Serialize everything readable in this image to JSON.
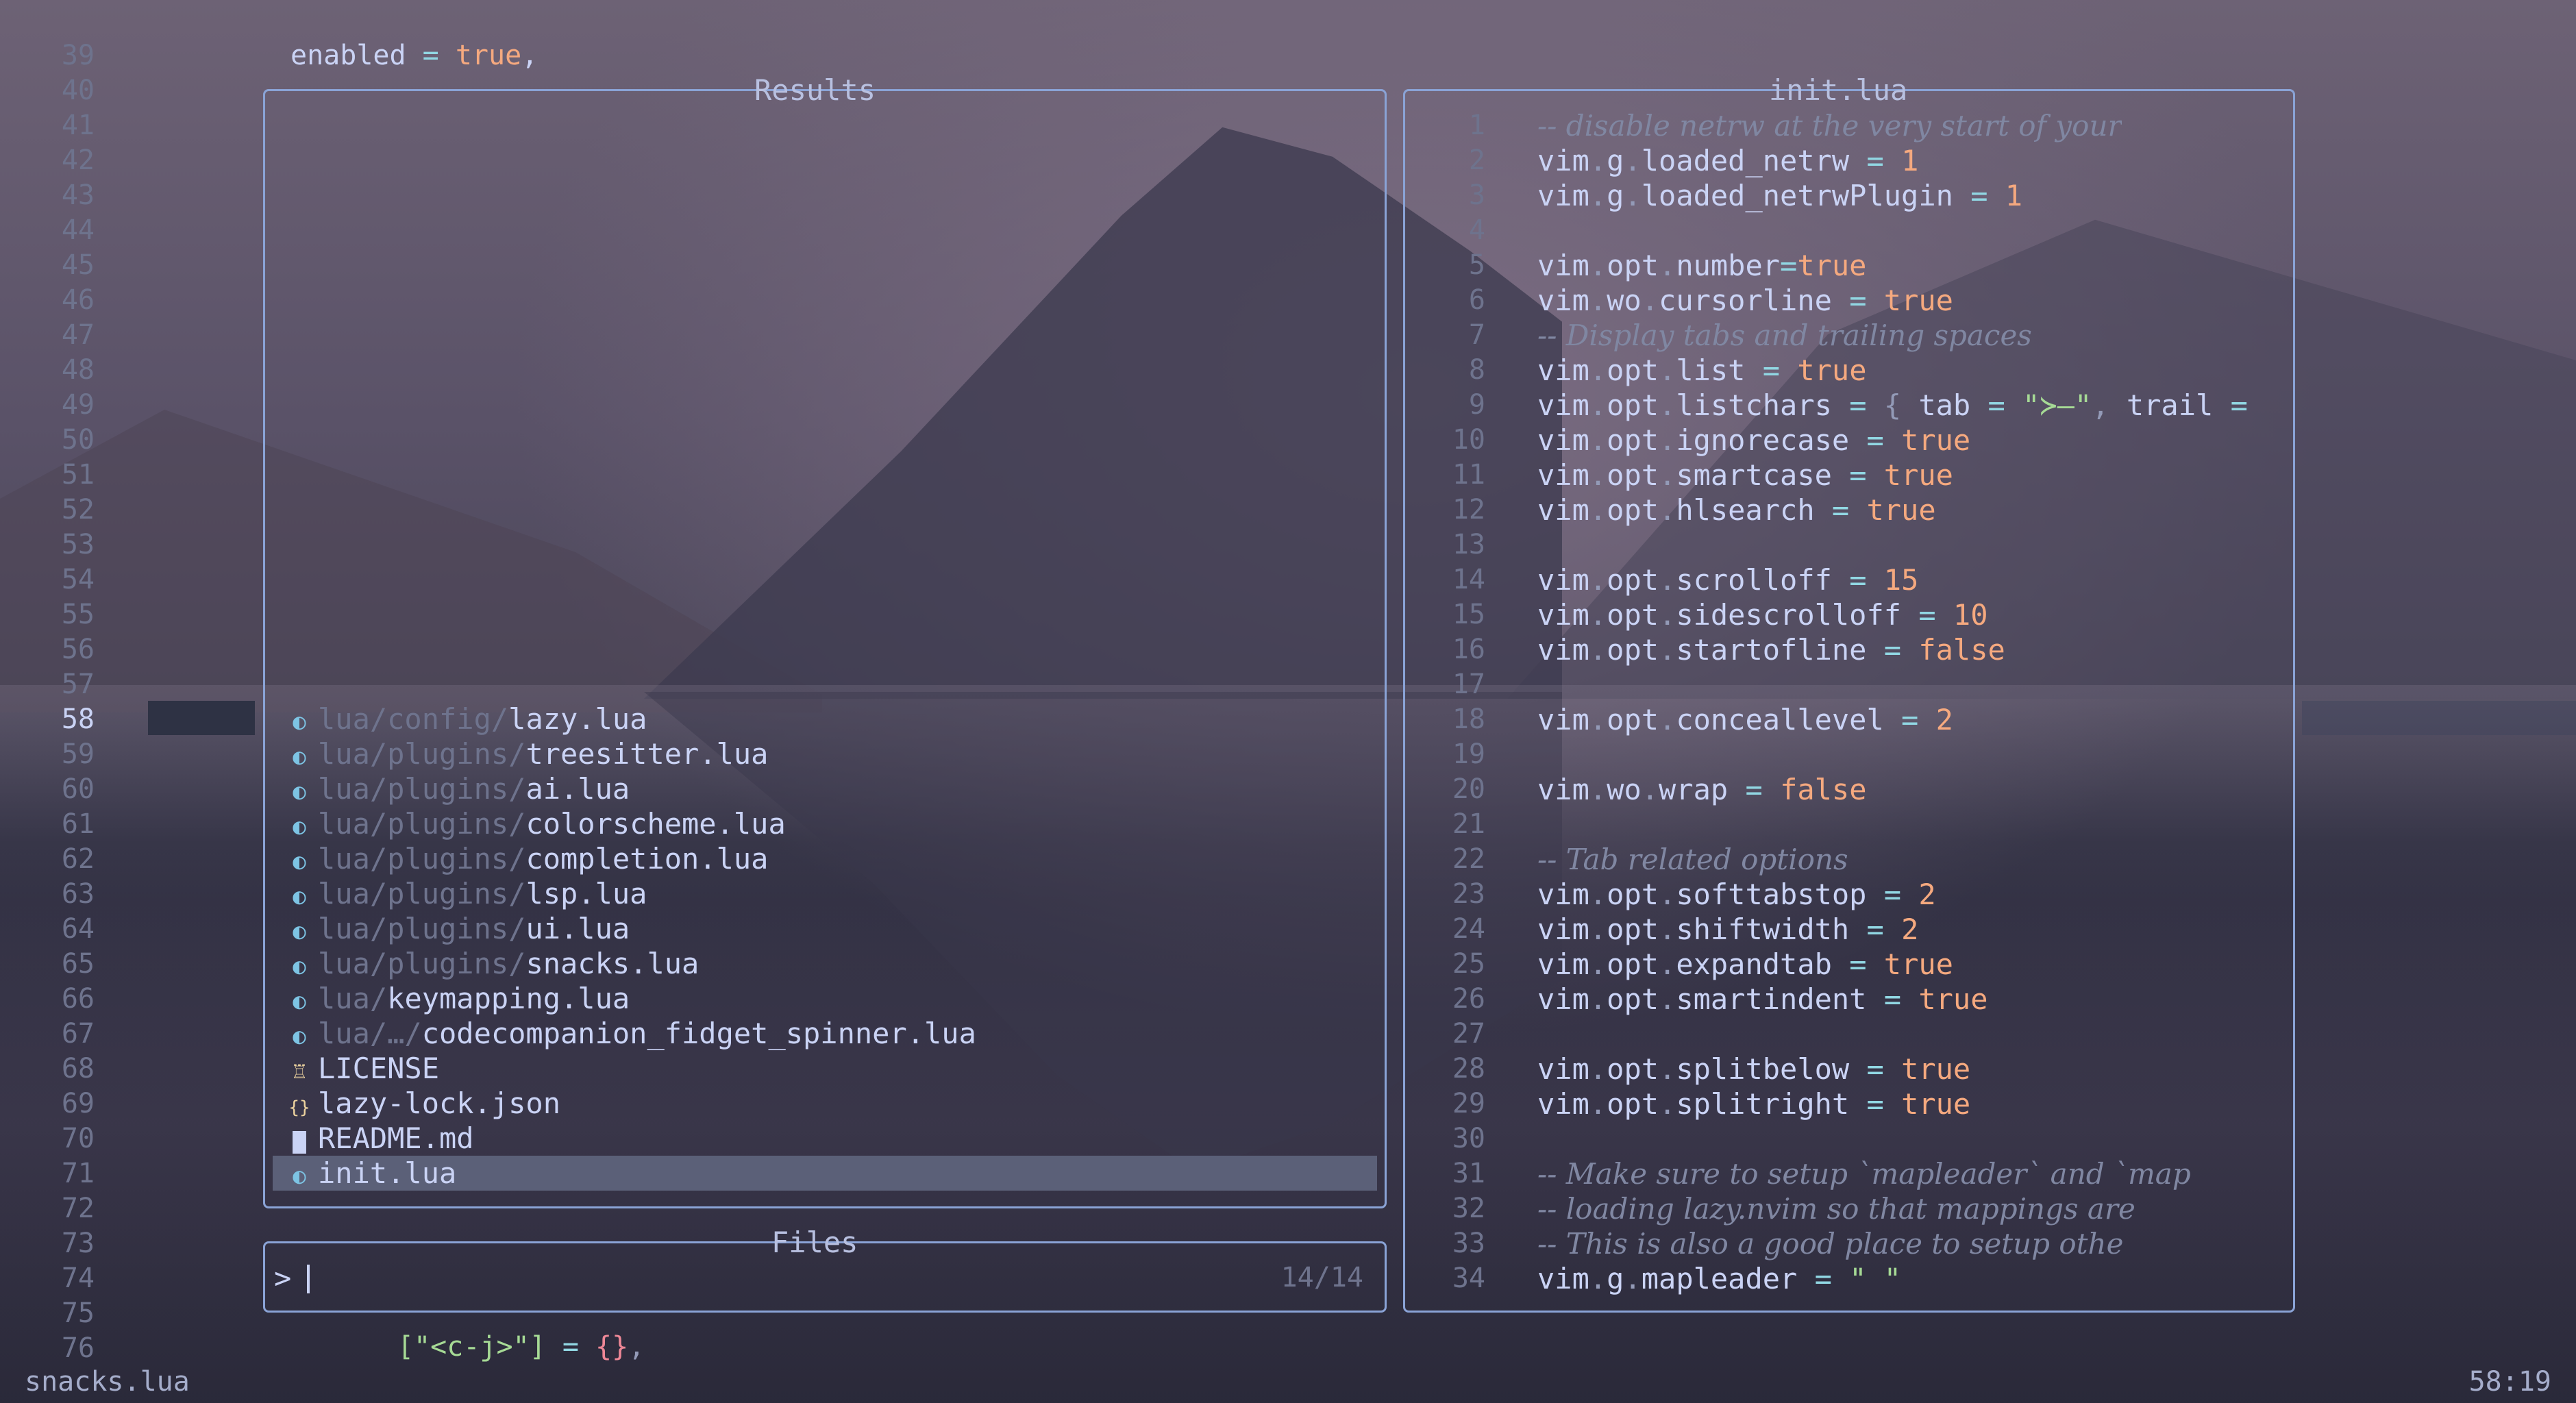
{
  "background_lines": {
    "top_text": "enabled = true,",
    "bottom_text": "[\"<c-j>\"] = {},",
    "line_numbers": [
      "39",
      "40",
      "41",
      "42",
      "43",
      "44",
      "45",
      "46",
      "47",
      "48",
      "49",
      "50",
      "51",
      "52",
      "53",
      "54",
      "55",
      "56",
      "57",
      "58",
      "59",
      "60",
      "61",
      "62",
      "63",
      "64",
      "65",
      "66",
      "67",
      "68",
      "69",
      "70",
      "71",
      "72",
      "73",
      "74",
      "75",
      "76"
    ],
    "current_line": "58"
  },
  "results": {
    "title": "Results",
    "items": [
      {
        "icon": "lua-icon",
        "dir": "lua/config/",
        "name": "lazy.lua"
      },
      {
        "icon": "lua-icon",
        "dir": "lua/plugins/",
        "name": "treesitter.lua"
      },
      {
        "icon": "lua-icon",
        "dir": "lua/plugins/",
        "name": "ai.lua"
      },
      {
        "icon": "lua-icon",
        "dir": "lua/plugins/",
        "name": "colorscheme.lua"
      },
      {
        "icon": "lua-icon",
        "dir": "lua/plugins/",
        "name": "completion.lua"
      },
      {
        "icon": "lua-icon",
        "dir": "lua/plugins/",
        "name": "lsp.lua"
      },
      {
        "icon": "lua-icon",
        "dir": "lua/plugins/",
        "name": "ui.lua"
      },
      {
        "icon": "lua-icon",
        "dir": "lua/plugins/",
        "name": "snacks.lua"
      },
      {
        "icon": "lua-icon",
        "dir": "lua/",
        "name": "keymapping.lua"
      },
      {
        "icon": "lua-icon",
        "dir": "lua/…/",
        "name": "codecompanion_fidget_spinner.lua"
      },
      {
        "icon": "license-icon",
        "dir": "",
        "name": "LICENSE"
      },
      {
        "icon": "json-icon",
        "dir": "",
        "name": "lazy-lock.json"
      },
      {
        "icon": "markdown-icon",
        "dir": "",
        "name": "README.md"
      },
      {
        "icon": "lua-icon",
        "dir": "",
        "name": "init.lua"
      }
    ],
    "selected_index": 13
  },
  "files": {
    "title": "Files",
    "prompt": ">",
    "count": "14/14"
  },
  "preview": {
    "title": "init.lua",
    "lines": [
      {
        "n": "1",
        "t": "-- disable netrw at the very start of your"
      },
      {
        "n": "2",
        "t": "vim.g.loaded_netrw = 1"
      },
      {
        "n": "3",
        "t": "vim.g.loaded_netrwPlugin = 1"
      },
      {
        "n": "4",
        "t": ""
      },
      {
        "n": "5",
        "t": "vim.opt.number=true"
      },
      {
        "n": "6",
        "t": "vim.wo.cursorline = true"
      },
      {
        "n": "7",
        "t": "-- Display tabs and trailing spaces"
      },
      {
        "n": "8",
        "t": "vim.opt.list = true"
      },
      {
        "n": "9",
        "t": "vim.opt.listchars = { tab = \"≻—\", trail ="
      },
      {
        "n": "10",
        "t": "vim.opt.ignorecase = true"
      },
      {
        "n": "11",
        "t": "vim.opt.smartcase = true"
      },
      {
        "n": "12",
        "t": "vim.opt.hlsearch = true"
      },
      {
        "n": "13",
        "t": ""
      },
      {
        "n": "14",
        "t": "vim.opt.scrolloff = 15"
      },
      {
        "n": "15",
        "t": "vim.opt.sidescrolloff = 10"
      },
      {
        "n": "16",
        "t": "vim.opt.startofline = false"
      },
      {
        "n": "17",
        "t": ""
      },
      {
        "n": "18",
        "t": "vim.opt.conceallevel = 2"
      },
      {
        "n": "19",
        "t": ""
      },
      {
        "n": "20",
        "t": "vim.wo.wrap = false"
      },
      {
        "n": "21",
        "t": ""
      },
      {
        "n": "22",
        "t": "-- Tab related options"
      },
      {
        "n": "23",
        "t": "vim.opt.softtabstop = 2"
      },
      {
        "n": "24",
        "t": "vim.opt.shiftwidth = 2"
      },
      {
        "n": "25",
        "t": "vim.opt.expandtab = true"
      },
      {
        "n": "26",
        "t": "vim.opt.smartindent = true"
      },
      {
        "n": "27",
        "t": ""
      },
      {
        "n": "28",
        "t": "vim.opt.splitbelow = true"
      },
      {
        "n": "29",
        "t": "vim.opt.splitright = true"
      },
      {
        "n": "30",
        "t": ""
      },
      {
        "n": "31",
        "t": "-- Make sure to setup `mapleader` and `map"
      },
      {
        "n": "32",
        "t": "-- loading lazy.nvim so that mappings are"
      },
      {
        "n": "33",
        "t": "-- This is also a good place to setup othe"
      },
      {
        "n": "34",
        "t": "vim.g.mapleader = \" \""
      }
    ]
  },
  "statusline": {
    "filename": "snacks.lua",
    "position": "58:19"
  },
  "colors": {
    "border": "#8aa3d6",
    "text": "#cad3f5",
    "comment": "#8087a2",
    "number": "#f5a97f",
    "string": "#a6da95",
    "selection": "#5b6078",
    "lua_icon": "#7dc4e4",
    "license_icon": "#eed49f",
    "json_icon": "#eed49f"
  }
}
